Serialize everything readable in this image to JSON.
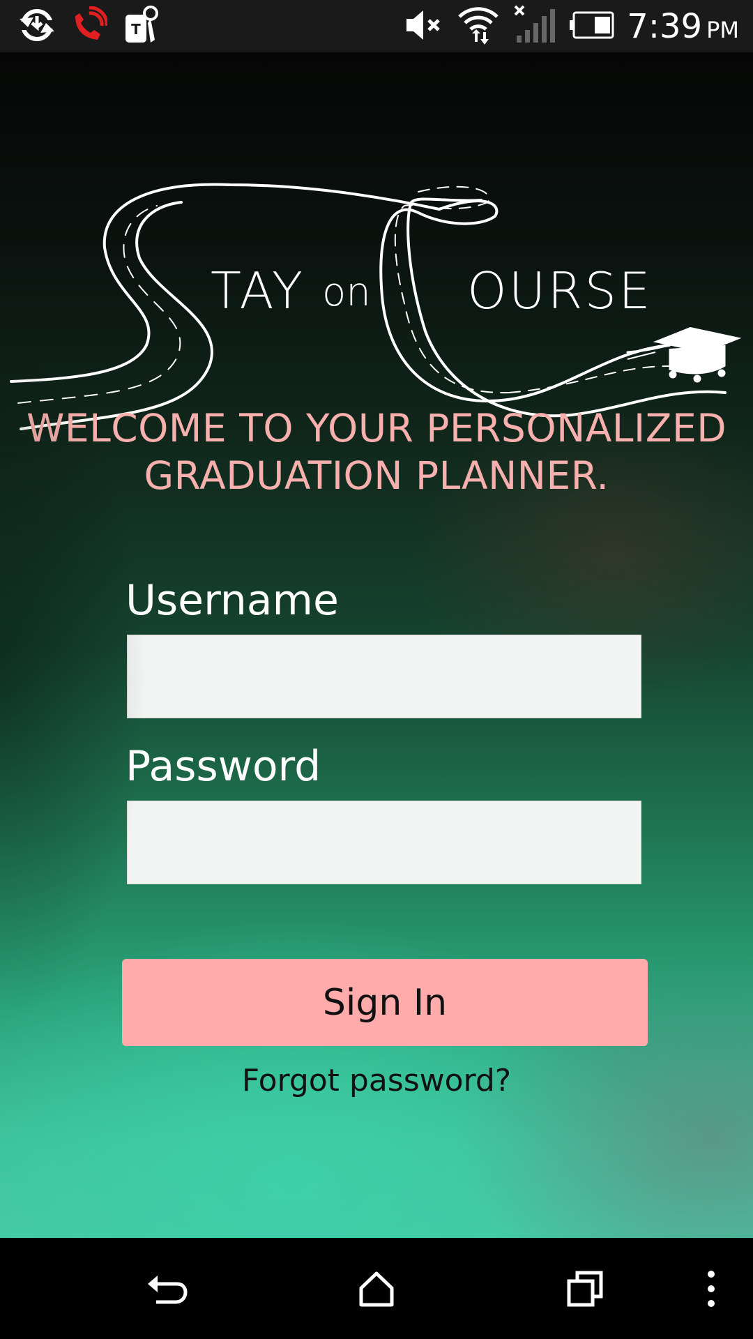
{
  "status_bar": {
    "time": "7:39",
    "ampm": "PM",
    "icons_left": [
      "sync-icon",
      "wifi-calling-icon",
      "tmobile-keys-icon"
    ],
    "icons_right": [
      "mute-icon",
      "wifi-icon",
      "cell-signal-icon",
      "battery-icon"
    ]
  },
  "logo": {
    "letter_s": "S",
    "text_tay": "TAY",
    "text_on": "on",
    "letter_c": "C",
    "text_ourse": "OURSE"
  },
  "welcome": {
    "line1": "WELCOME TO YOUR PERSONALIZED",
    "line2": "GRADUATION PLANNER."
  },
  "form": {
    "username_label": "Username",
    "username_value": "",
    "password_label": "Password",
    "password_value": "",
    "signin_label": "Sign In",
    "forgot_label": "Forgot password?"
  },
  "colors": {
    "accent_pink": "#ffabab",
    "welcome_text": "#f7b0ad",
    "input_bg": "#f2f4f3"
  },
  "nav_bar": {
    "buttons": [
      "back-icon",
      "home-icon",
      "recents-icon",
      "overflow-menu-icon"
    ]
  }
}
